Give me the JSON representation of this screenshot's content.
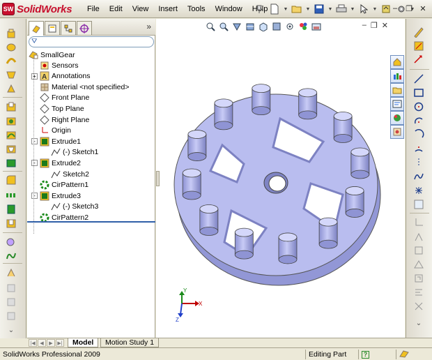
{
  "app": {
    "logo_badge": "SW",
    "logo_text": "SolidWorks"
  },
  "menu": [
    "File",
    "Edit",
    "View",
    "Insert",
    "Tools",
    "Window",
    "Help"
  ],
  "feature_tree": {
    "root": "SmallGear",
    "items": [
      {
        "label": "Sensors",
        "icon": "sensors-icon",
        "indent": 1,
        "expander": ""
      },
      {
        "label": "Annotations",
        "icon": "annotations-icon",
        "indent": 1,
        "expander": "+"
      },
      {
        "label": "Material <not specified>",
        "icon": "material-icon",
        "indent": 1,
        "expander": ""
      },
      {
        "label": "Front Plane",
        "icon": "plane-icon",
        "indent": 1,
        "expander": ""
      },
      {
        "label": "Top Plane",
        "icon": "plane-icon",
        "indent": 1,
        "expander": ""
      },
      {
        "label": "Right Plane",
        "icon": "plane-icon",
        "indent": 1,
        "expander": ""
      },
      {
        "label": "Origin",
        "icon": "origin-icon",
        "indent": 1,
        "expander": ""
      },
      {
        "label": "Extrude1",
        "icon": "extrude-icon",
        "indent": 1,
        "expander": "-"
      },
      {
        "label": "(-) Sketch1",
        "icon": "sketch-icon",
        "indent": 2,
        "expander": ""
      },
      {
        "label": "Extrude2",
        "icon": "extrude-icon",
        "indent": 1,
        "expander": "-"
      },
      {
        "label": "Sketch2",
        "icon": "sketch-icon",
        "indent": 2,
        "expander": ""
      },
      {
        "label": "CirPattern1",
        "icon": "circular-pattern-icon",
        "indent": 1,
        "expander": ""
      },
      {
        "label": "Extrude3",
        "icon": "extrude-icon",
        "indent": 1,
        "expander": "-"
      },
      {
        "label": "(-) Sketch3",
        "icon": "sketch-icon",
        "indent": 2,
        "expander": ""
      },
      {
        "label": "CirPattern2",
        "icon": "circular-pattern-icon",
        "indent": 1,
        "expander": ""
      }
    ]
  },
  "bottom_tabs": {
    "model": "Model",
    "motion": "Motion Study 1"
  },
  "status": {
    "product": "SolidWorks Professional 2009",
    "mode": "Editing Part",
    "help": "?"
  },
  "triad": {
    "x": "X",
    "y": "Y",
    "z": "Z"
  },
  "colors": {
    "part": "#b9bdef",
    "part_dark": "#7f84c4",
    "brand": "#c8102e",
    "axis_x": "#c00000",
    "axis_y": "#1a8a1a",
    "axis_z": "#1f3fc9"
  }
}
